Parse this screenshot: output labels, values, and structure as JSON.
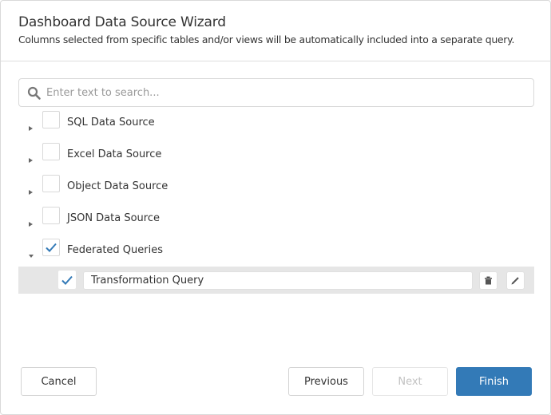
{
  "dialog": {
    "title": "Dashboard Data Source Wizard",
    "subtitle": "Columns selected from specific tables and/or views will be automatically included into a separate query."
  },
  "search": {
    "placeholder": "Enter text to search...",
    "value": "",
    "icon": "search-icon"
  },
  "tree": {
    "items": [
      {
        "label": "SQL Data Source",
        "expanded": false,
        "checked": false
      },
      {
        "label": "Excel Data Source",
        "expanded": false,
        "checked": false
      },
      {
        "label": "Object Data Source",
        "expanded": false,
        "checked": false
      },
      {
        "label": "JSON Data Source",
        "expanded": false,
        "checked": false
      },
      {
        "label": "Federated Queries",
        "expanded": true,
        "checked": true
      }
    ],
    "children": [
      {
        "name": "Transformation Query",
        "checked": true,
        "delete_icon": "trash-icon",
        "edit_icon": "pencil-icon"
      }
    ]
  },
  "footer": {
    "cancel_label": "Cancel",
    "previous_label": "Previous",
    "next_label": "Next",
    "finish_label": "Finish",
    "next_enabled": false
  },
  "colors": {
    "accent": "#337ab7",
    "check": "#337ab7",
    "selected_row": "#e6e6e6"
  }
}
